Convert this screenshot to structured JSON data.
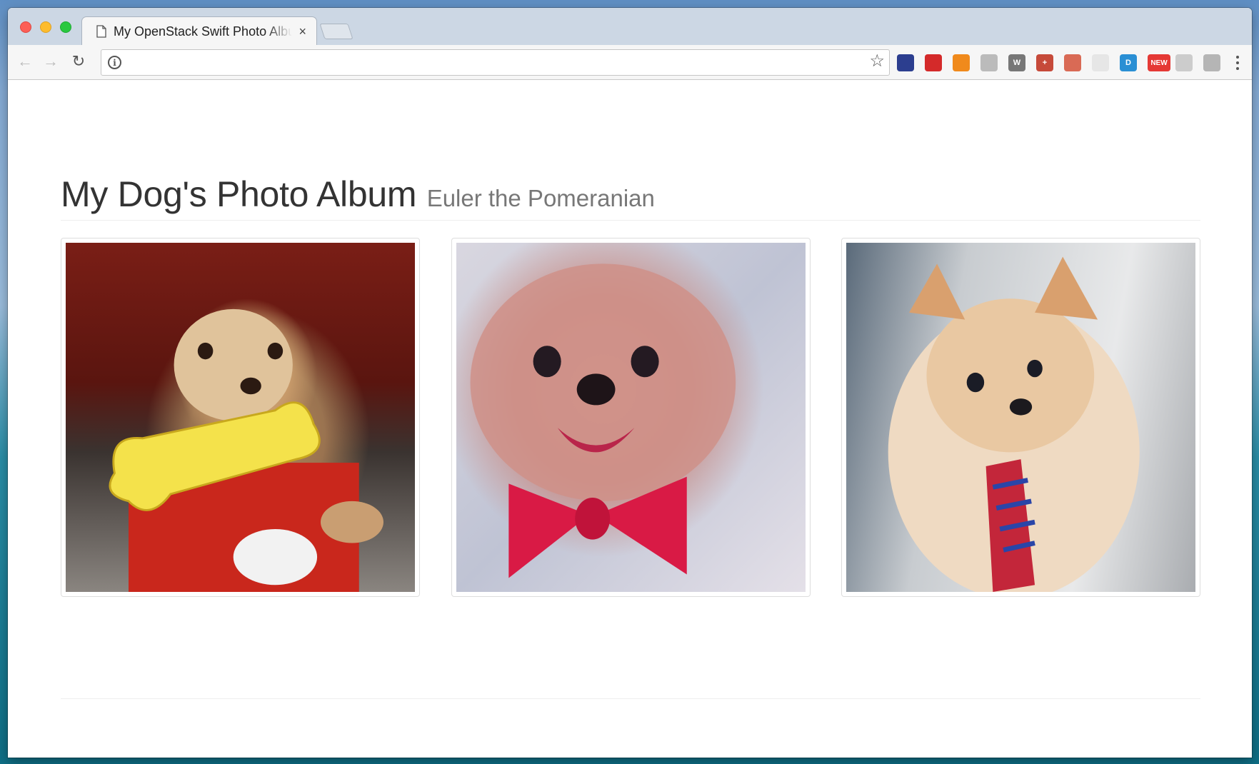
{
  "browser": {
    "tab_title": "My OpenStack Swift Photo Album",
    "tab_close": "×",
    "url": "",
    "nav": {
      "back": "←",
      "forward": "→",
      "reload": "↻"
    },
    "info_icon": "i",
    "star_icon": "☆",
    "extensions": [
      {
        "name": "ext-1-icon",
        "label": "",
        "color": "#2c3e8f"
      },
      {
        "name": "ext-stop-icon",
        "label": "",
        "color": "#d42a2a"
      },
      {
        "name": "ext-chart-icon",
        "label": "",
        "color": "#f08a1c"
      },
      {
        "name": "ext-magnifier-icon",
        "label": "",
        "color": "#bbbbbb"
      },
      {
        "name": "ext-shield-icon",
        "label": "W",
        "color": "#777777"
      },
      {
        "name": "ext-cross-icon",
        "label": "+",
        "color": "#c64a3a"
      },
      {
        "name": "ext-diamond-icon",
        "label": "",
        "color": "#d96a55"
      },
      {
        "name": "ext-doc-icon",
        "label": "",
        "color": "#e6e6e6"
      },
      {
        "name": "ext-d-icon",
        "label": "D",
        "color": "#2a8fd4"
      },
      {
        "name": "ext-new-icon",
        "label": "NEW",
        "color": "#e53935"
      },
      {
        "name": "ext-gear-icon",
        "label": "",
        "color": "#cccccc"
      },
      {
        "name": "ext-drive-icon",
        "label": "",
        "color": "#b5b5b5"
      }
    ]
  },
  "page": {
    "title": "My Dog's Photo Album",
    "subtitle": "Euler the Pomeranian",
    "photos": [
      {
        "name": "dog-photo-bone"
      },
      {
        "name": "dog-photo-bowtie"
      },
      {
        "name": "dog-photo-necktie"
      }
    ]
  },
  "colors": {
    "title_text": "#333333",
    "subtitle_text": "#777777",
    "thumbnail_border": "#dddddd"
  }
}
